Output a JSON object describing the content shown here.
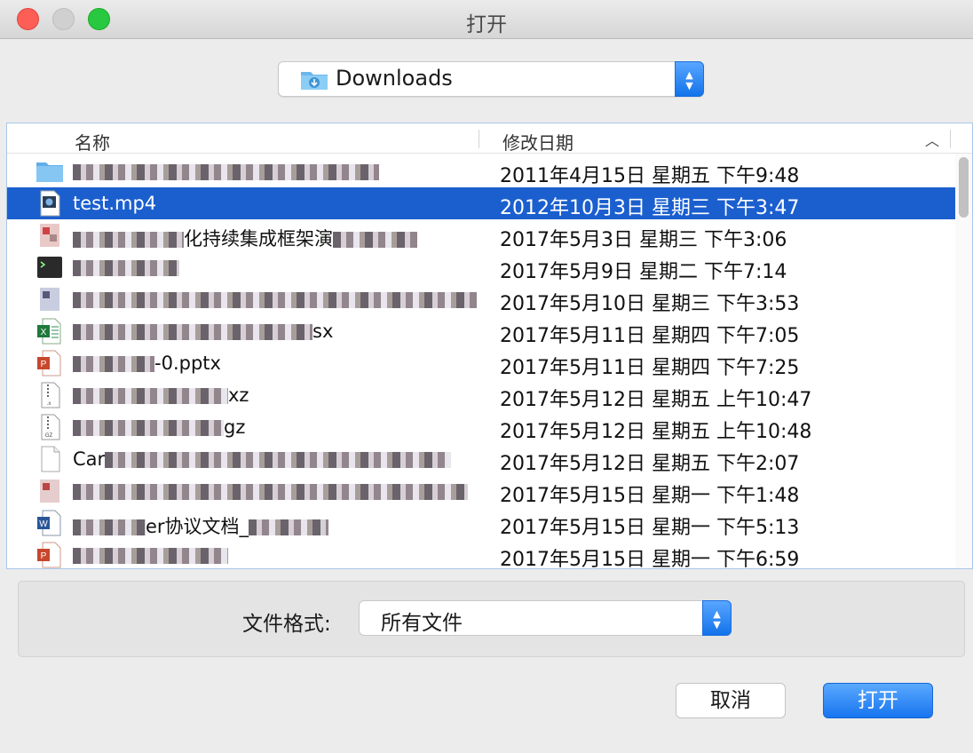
{
  "window": {
    "title": "打开"
  },
  "location": {
    "label": "Downloads"
  },
  "columns": {
    "name": "名称",
    "date": "修改日期"
  },
  "files": [
    {
      "icon": "folder-icon",
      "name_visible": "",
      "date": "2011年4月15日 星期五 下午9:48",
      "selected": false
    },
    {
      "icon": "video-file-icon",
      "name_visible": "test.mp4",
      "date": "2012年10月3日 星期三 下午3:47",
      "selected": true
    },
    {
      "icon": "image-file-icon",
      "name_visible": "化持续集成框架演",
      "date": "2017年5月3日 星期三 下午3:06",
      "selected": false
    },
    {
      "icon": "terminal-file-icon",
      "name_visible": "",
      "date": "2017年5月9日 星期二 下午7:14",
      "selected": false
    },
    {
      "icon": "image-file-icon",
      "name_visible": "",
      "date": "2017年5月10日 星期三 下午3:53",
      "selected": false
    },
    {
      "icon": "excel-file-icon",
      "name_visible": "sx",
      "date": "2017年5月11日 星期四 下午7:05",
      "selected": false
    },
    {
      "icon": "powerpoint-file-icon",
      "name_visible": "-0.pptx",
      "date": "2017年5月11日 星期四 下午7:25",
      "selected": false
    },
    {
      "icon": "xz-archive-icon",
      "name_visible": "xz",
      "date": "2017年5月12日 星期五 上午10:47",
      "selected": false
    },
    {
      "icon": "gz-archive-icon",
      "name_visible": "gz",
      "date": "2017年5月12日 星期五 上午10:48",
      "selected": false
    },
    {
      "icon": "document-file-icon",
      "name_visible": "Car",
      "date": "2017年5月12日 星期五 下午2:07",
      "selected": false
    },
    {
      "icon": "image-file-icon",
      "name_visible": "",
      "date": "2017年5月15日 星期一 下午1:48",
      "selected": false
    },
    {
      "icon": "word-file-icon",
      "name_visible": "er协议文档_",
      "date": "2017年5月15日 星期一 下午5:13",
      "selected": false
    },
    {
      "icon": "powerpoint-file-icon",
      "name_visible": "",
      "date": "2017年5月15日 星期一 下午6:59",
      "selected": false
    }
  ],
  "format": {
    "label": "文件格式:",
    "value": "所有文件"
  },
  "buttons": {
    "cancel": "取消",
    "open": "打开"
  },
  "colors": {
    "selection": "#1b5fcf",
    "accent": "#1875ef"
  }
}
